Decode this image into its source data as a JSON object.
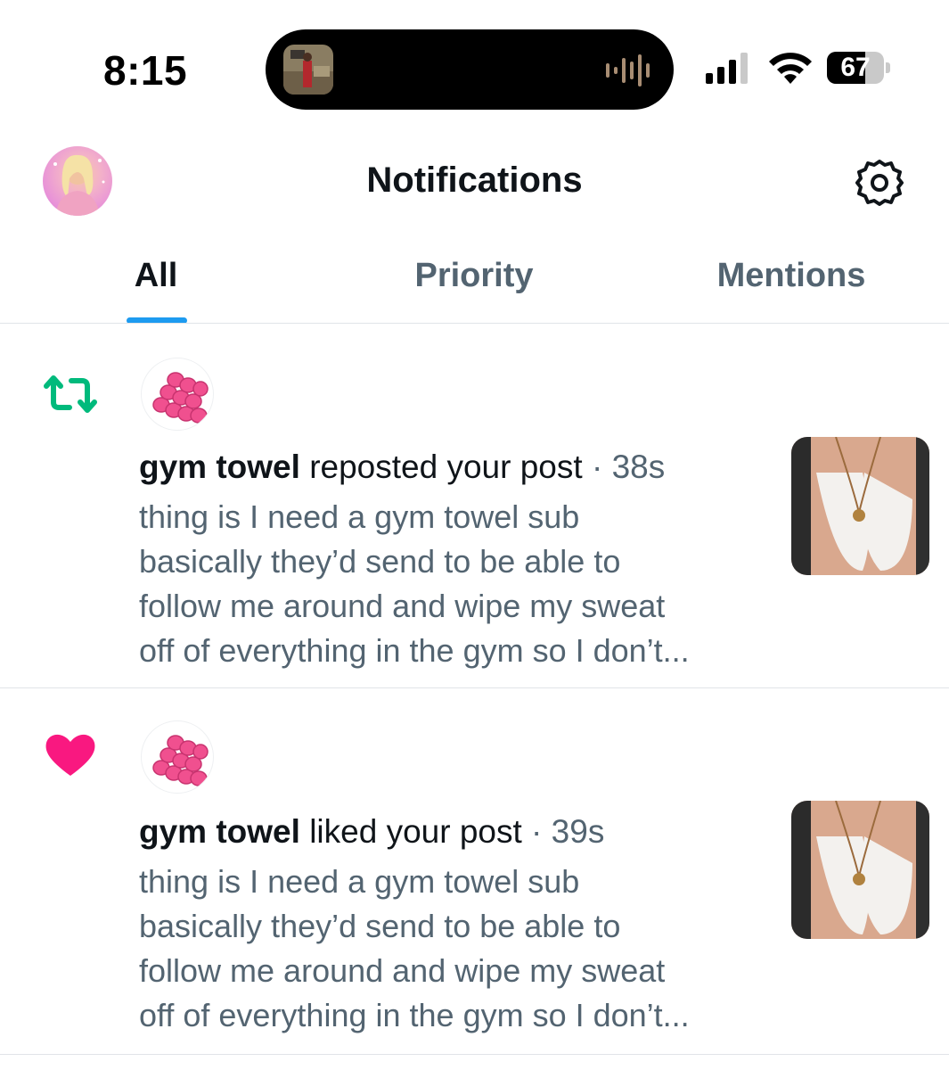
{
  "status_bar": {
    "time": "8:15",
    "battery_percent": 67,
    "battery_label": "67",
    "signal_bars_active": 3,
    "icons": [
      "now-playing-artwork",
      "audio-waveform-icon",
      "cellular-signal-icon",
      "wifi-icon",
      "battery-icon"
    ]
  },
  "header": {
    "title": "Notifications",
    "settings_icon": "gear-icon"
  },
  "tabs": [
    {
      "label": "All",
      "active": true
    },
    {
      "label": "Priority",
      "active": false
    },
    {
      "label": "Mentions",
      "active": false
    }
  ],
  "notifications": [
    {
      "type_icon": "repost-icon",
      "actor": "gym towel",
      "action": "reposted your post",
      "separator": " · ",
      "time": "38s",
      "text_lines": [
        "thing is I need a gym towel sub",
        "basically they’d send to be able to",
        "follow me around and wipe my sweat",
        "off of everything in the gym so I don’t..."
      ]
    },
    {
      "type_icon": "heart-icon",
      "actor": "gym towel",
      "action": "liked your post",
      "separator": " · ",
      "time": "39s",
      "text_lines": [
        "thing is I need a gym towel sub",
        "basically they’d send to be able to",
        "follow me around and wipe my sweat",
        "off of everything in the gym so I don’t..."
      ]
    }
  ],
  "colors": {
    "accent": "#1d9bf0",
    "repost": "#00ba7c",
    "like": "#f91880",
    "primary_text": "#0f1419",
    "secondary_text": "#536471"
  }
}
